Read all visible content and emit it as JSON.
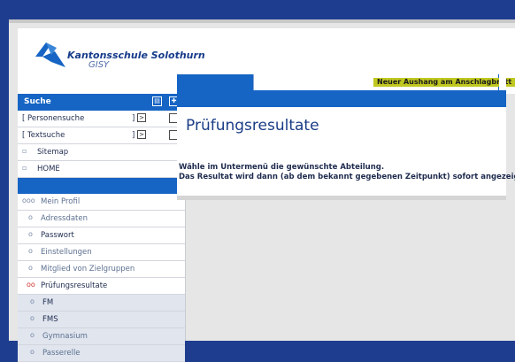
{
  "brand": {
    "name": "Kantonsschule Solothurn",
    "subtitle": "GISY"
  },
  "sidebar": {
    "header": "Suche",
    "search_rows": [
      {
        "label": "[ Personensuche",
        "bracket": "]",
        "button": ">"
      },
      {
        "label": "[ Textsuche",
        "bracket": "]",
        "button": ">"
      }
    ],
    "links": [
      {
        "label": "Sitemap"
      },
      {
        "label": "HOME"
      }
    ],
    "menu": [
      {
        "label": "Mein Profil",
        "bullet": "ooo"
      },
      {
        "label": "Adressdaten",
        "bullet": "o"
      },
      {
        "label": "Passwort",
        "bullet": "o"
      },
      {
        "label": "Einstellungen",
        "bullet": "o"
      },
      {
        "label": "Mitglied von Zielgruppen",
        "bullet": "o"
      },
      {
        "label": "Prüfungsresultate",
        "bullet": "oo"
      }
    ],
    "submenu": [
      {
        "label": "FM",
        "bullet": "o"
      },
      {
        "label": "FMS",
        "bullet": "o"
      },
      {
        "label": "Gymnasium",
        "bullet": "o"
      },
      {
        "label": "Passerelle",
        "bullet": "o"
      }
    ]
  },
  "main": {
    "tab_notice": "Neuer Aushang am Anschlagbrett",
    "title": "Prüfungsresultate",
    "info_line1": "Wähle im Untermenü die gewünschte Abteilung.",
    "info_line2": "Das Resultat wird dann (ab dem bekannt gegebenen Zeitpunkt) sofort angezeigt."
  },
  "colors": {
    "background": "#1f3d8f",
    "accent_blue": "#1664c4",
    "notice_bg": "#c0c820",
    "active_bullet": "#d0312d"
  }
}
